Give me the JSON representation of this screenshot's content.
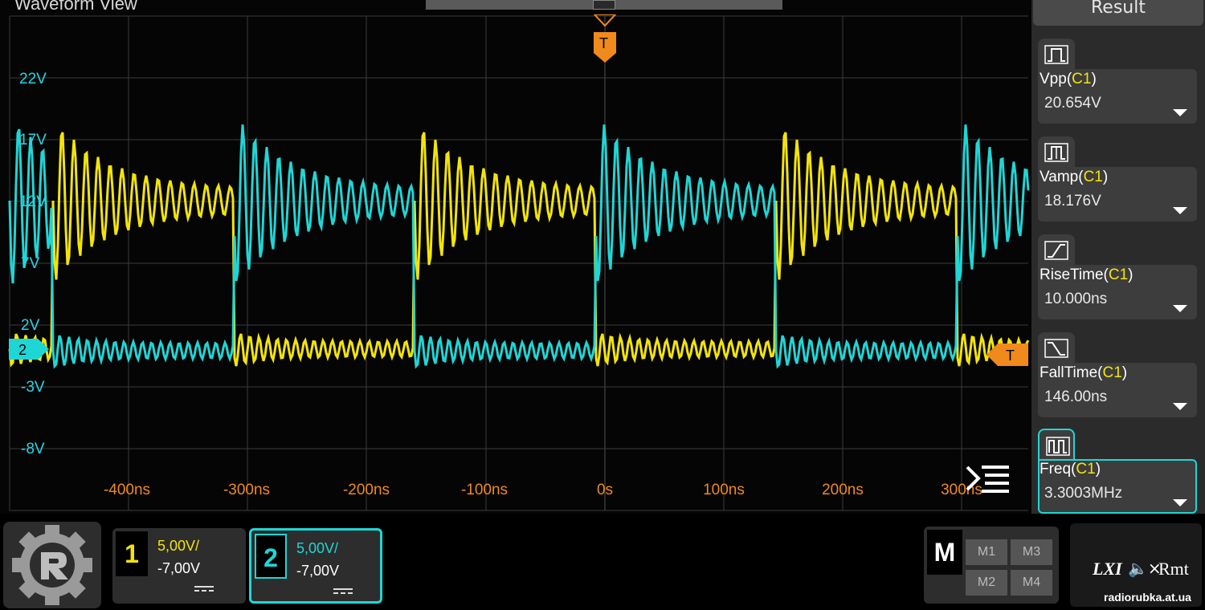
{
  "waveform": {
    "title": "Waveform View",
    "volt_labels": [
      "22V",
      "17V",
      "12V",
      "7V",
      "2V",
      "-3V",
      "-8V"
    ],
    "time_labels": [
      "-400ns",
      "-300ns",
      "-200ns",
      "-100ns",
      "0s",
      "100ns",
      "200ns",
      "300ns"
    ],
    "ch2_marker": "2",
    "trigger_label": "T",
    "colors": {
      "ch1": "#f2e40a",
      "ch2": "#1fd6d6",
      "trigger": "#f08a1c",
      "grid": "#3a3a3a"
    },
    "icons": {
      "menu": "menu-lines-icon",
      "trigger": "trigger-flag-icon"
    }
  },
  "result_panel": {
    "header": "Result",
    "measurements": [
      {
        "name": "Vpp",
        "source": "C1",
        "value": "20.654V",
        "icon": "vpp-icon"
      },
      {
        "name": "Vamp",
        "source": "C1",
        "value": "18.176V",
        "icon": "vamp-icon"
      },
      {
        "name": "RiseTime",
        "source": "C1",
        "value": "10.000ns",
        "icon": "rise-time-icon"
      },
      {
        "name": "FallTime",
        "source": "C1",
        "value": "146.00ns",
        "icon": "fall-time-icon"
      },
      {
        "name": "Freq",
        "source": "C1",
        "value": "3.3003MHz",
        "icon": "freq-icon",
        "active": true
      }
    ]
  },
  "bottom_bar": {
    "ch1": {
      "number": "1",
      "scale": "5,00V/",
      "offset": "-7,00V"
    },
    "ch2": {
      "number": "2",
      "scale": "5,00V/",
      "offset": "-7,00V"
    },
    "math": {
      "letter": "M",
      "buttons": [
        "M1",
        "M3",
        "M2",
        "M4"
      ]
    },
    "status": {
      "lxi": "LXI",
      "rmt": "Rmt",
      "speaker": "🔈×"
    }
  },
  "watermark": "radiorubka.at.ua"
}
